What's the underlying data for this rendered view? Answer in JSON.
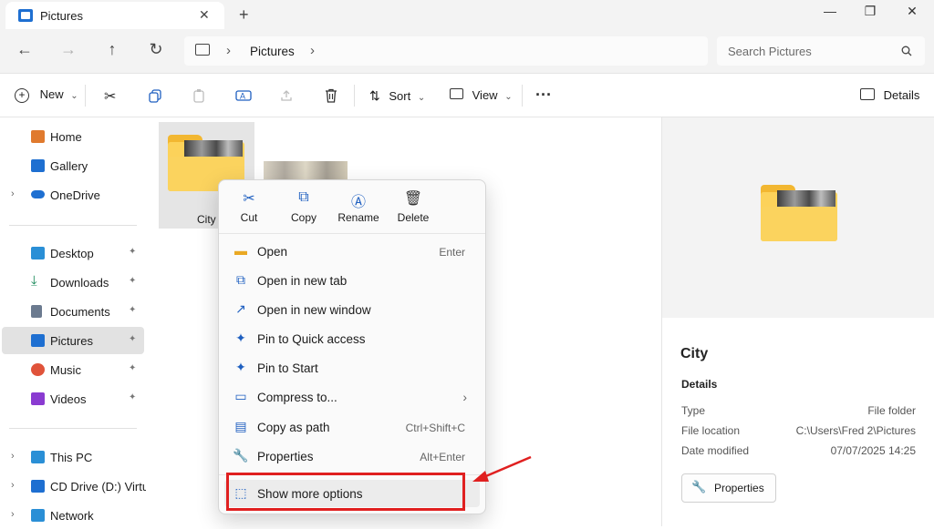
{
  "tab": {
    "title": "Pictures",
    "close": "✕",
    "new_tab": "+"
  },
  "window_controls": {
    "minimize": "—",
    "maximize": "❐",
    "close": "✕"
  },
  "nav": {
    "back": "←",
    "forward": "→",
    "up": "↑",
    "refresh": "↻"
  },
  "breadcrumb": {
    "sep1": "›",
    "location": "Pictures",
    "sep2": "›"
  },
  "search": {
    "placeholder": "Search Pictures"
  },
  "toolbar": {
    "new_label": "New",
    "sort_label": "Sort",
    "view_label": "View",
    "more": "···",
    "details_label": "Details",
    "dropdown": "⌄"
  },
  "sidebar": {
    "items": [
      {
        "label": "Home",
        "color": "#e07a2e"
      },
      {
        "label": "Gallery",
        "color": "#1e6fd1"
      },
      {
        "label": "OneDrive",
        "color": "#1e6fd1"
      },
      {
        "label": "Desktop",
        "color": "#2a8fd6"
      },
      {
        "label": "Downloads",
        "color": "#1a8a5a"
      },
      {
        "label": "Documents",
        "color": "#6b7a8f"
      },
      {
        "label": "Pictures",
        "color": "#1e6fd1"
      },
      {
        "label": "Music",
        "color": "#e0533a"
      },
      {
        "label": "Videos",
        "color": "#8a3bd1"
      },
      {
        "label": "This PC",
        "color": "#2a8fd6"
      },
      {
        "label": "CD Drive (D:) Virtua",
        "color": "#1e6fd1"
      },
      {
        "label": "Network",
        "color": "#2a8fd6"
      }
    ],
    "pin": "📌",
    "chevron": "›"
  },
  "content": {
    "item_name": "City"
  },
  "context_menu": {
    "quick_actions": [
      {
        "label": "Cut",
        "icon": "scissors-icon"
      },
      {
        "label": "Copy",
        "icon": "copy-icon"
      },
      {
        "label": "Rename",
        "icon": "rename-icon"
      },
      {
        "label": "Delete",
        "icon": "trash-icon"
      }
    ],
    "items": [
      {
        "label": "Open",
        "shortcut": "Enter"
      },
      {
        "label": "Open in new tab",
        "shortcut": ""
      },
      {
        "label": "Open in new window",
        "shortcut": ""
      },
      {
        "label": "Pin to Quick access",
        "shortcut": ""
      },
      {
        "label": "Pin to Start",
        "shortcut": ""
      },
      {
        "label": "Compress to...",
        "shortcut": ""
      },
      {
        "label": "Copy as path",
        "shortcut": "Ctrl+Shift+C"
      },
      {
        "label": "Properties",
        "shortcut": "Alt+Enter"
      }
    ],
    "show_more": "Show more options",
    "submenu_arrow": "›"
  },
  "details_pane": {
    "title": "City",
    "section": "Details",
    "rows": [
      {
        "label": "Type",
        "value": "File folder"
      },
      {
        "label": "File location",
        "value": "C:\\Users\\Fred 2\\Pictures"
      },
      {
        "label": "Date modified",
        "value": "07/07/2025 14:25"
      }
    ],
    "properties_button": "Properties"
  },
  "colors": {
    "accent": "#1e6fd1",
    "highlight_box": "#e02020",
    "folder": "#fcd25a"
  }
}
